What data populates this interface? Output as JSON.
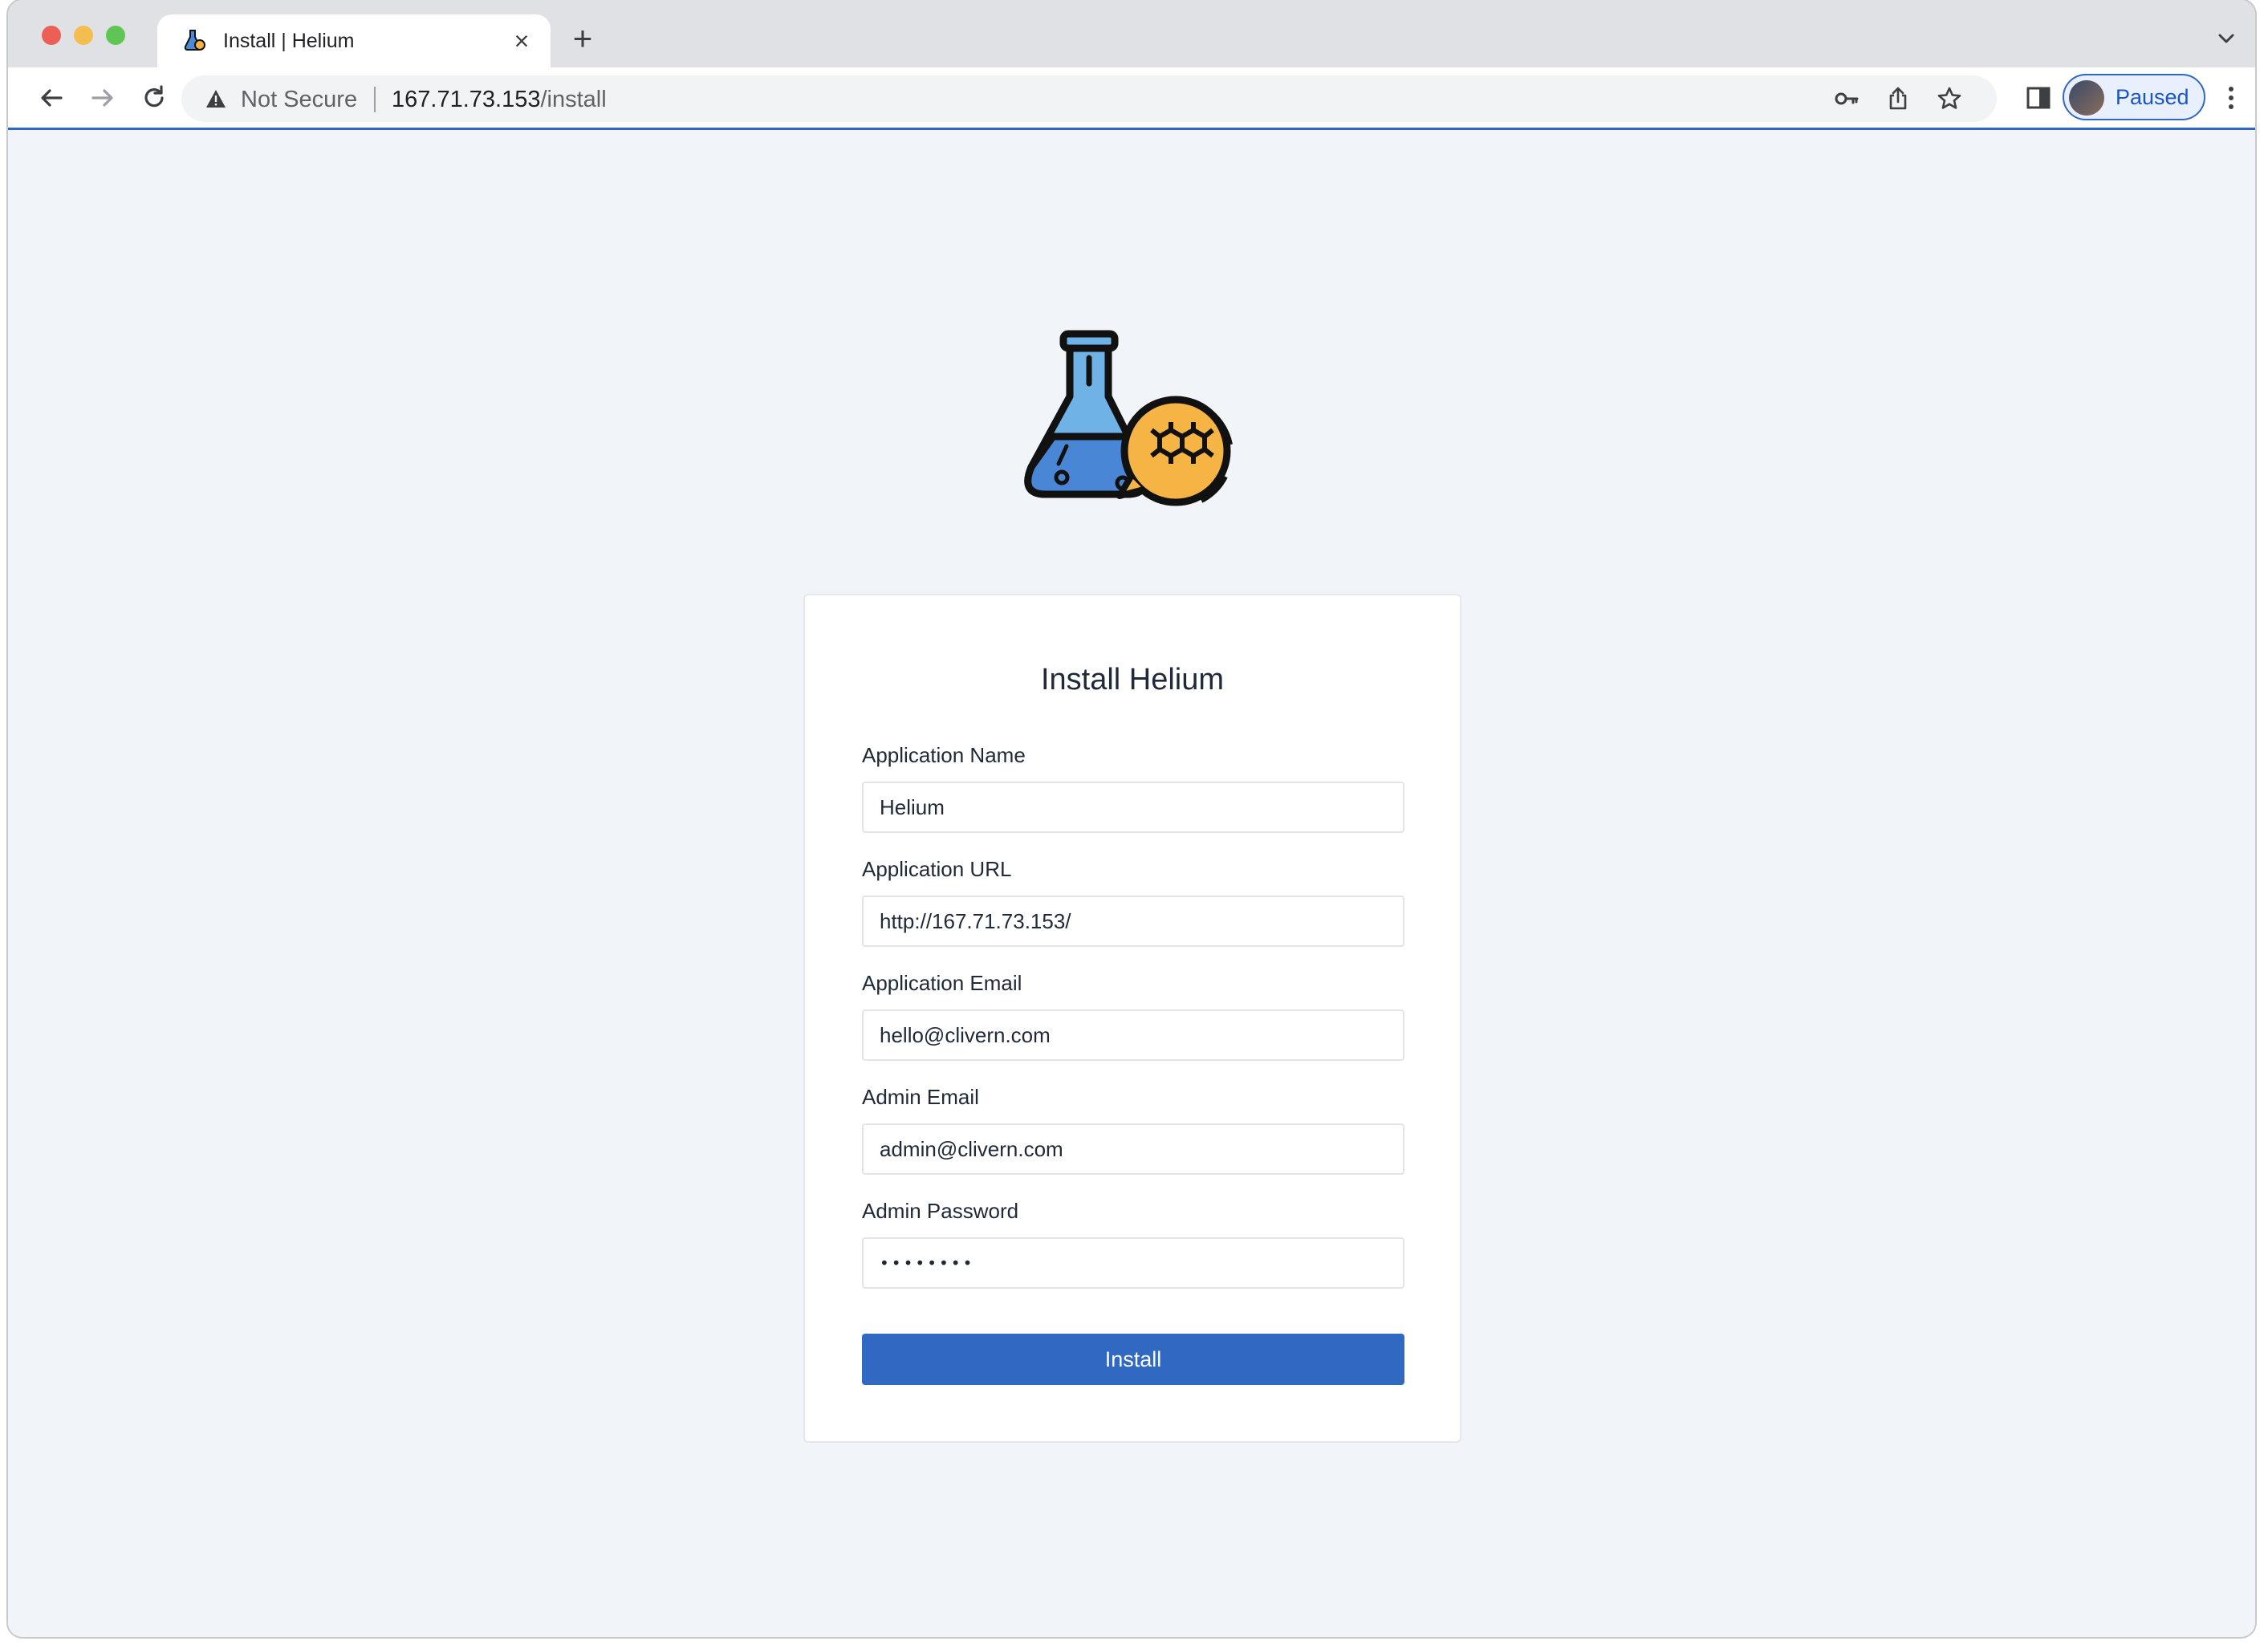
{
  "browser": {
    "tab": {
      "title": "Install | Helium",
      "favicon": "flask-icon"
    },
    "address": {
      "security_label": "Not Secure",
      "host": "167.71.73.153",
      "path": "/install"
    },
    "profile": {
      "label": "Paused"
    },
    "icons": {
      "back": "back-arrow-icon",
      "forward": "forward-arrow-icon",
      "reload": "reload-icon",
      "key": "key-icon",
      "share": "share-icon",
      "bookmark": "star-icon",
      "sidepanel": "side-panel-icon",
      "menu": "more-vert-icon"
    }
  },
  "page": {
    "logo": "flask-molecule-logo",
    "card_title": "Install Helium",
    "fields": {
      "app_name": {
        "label": "Application Name",
        "value": "Helium"
      },
      "app_url": {
        "label": "Application URL",
        "value": "http://167.71.73.153/"
      },
      "app_email": {
        "label": "Application Email",
        "value": "hello@clivern.com"
      },
      "admin_email": {
        "label": "Admin Email",
        "value": "admin@clivern.com"
      },
      "admin_password": {
        "label": "Admin Password",
        "value": "••••••••"
      }
    },
    "submit_label": "Install"
  },
  "colors": {
    "accent": "#3169c2",
    "page_background": "#f1f4f8",
    "card_background": "#ffffff"
  }
}
